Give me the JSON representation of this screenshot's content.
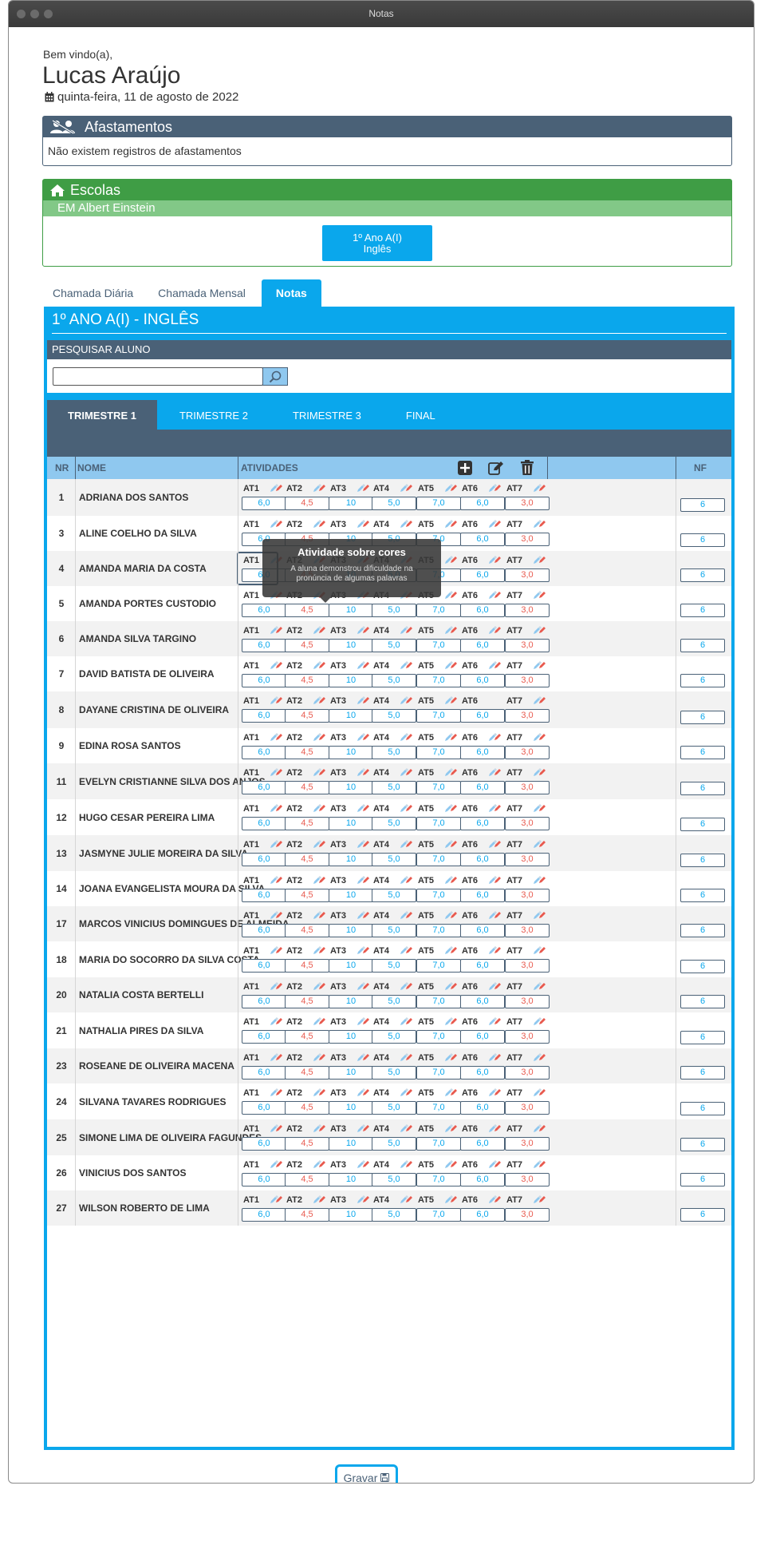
{
  "window": {
    "title": "Notas"
  },
  "header": {
    "welcome": "Bem vindo(a),",
    "user_name": "Lucas Araújo",
    "date": "quinta-feira, 11 de agosto de 2022"
  },
  "afastamentos": {
    "title": "Afastamentos",
    "message": "Não existem registros de afastamentos"
  },
  "escolas": {
    "title": "Escolas",
    "school_name": "EM Albert Einstein",
    "class_button_line1": "1º Ano A(I)",
    "class_button_line2": "Inglês"
  },
  "tabs": [
    {
      "label": "Chamada Diária",
      "active": false
    },
    {
      "label": "Chamada Mensal",
      "active": false
    },
    {
      "label": "Notas",
      "active": true
    }
  ],
  "notas": {
    "class_title": "1º ANO A(I) - INGLÊS",
    "search_label": "PESQUISAR ALUNO",
    "search_value": "",
    "trimestres": [
      "TRIMESTRE 1",
      "TRIMESTRE 2",
      "TRIMESTRE 3",
      "FINAL"
    ],
    "active_trimestre": 0,
    "columns": {
      "nr": "NR",
      "nome": "NOME",
      "atividades": "ATIVIDADES",
      "nf": "NF"
    },
    "activities": [
      "AT1",
      "AT2",
      "AT3",
      "AT4",
      "AT5",
      "AT6",
      "AT7"
    ],
    "grades": [
      "6,0",
      "4,5",
      "10",
      "5,0",
      "7,0",
      "6,0",
      "3,0"
    ],
    "grade_colors": [
      "blue",
      "red",
      "blue",
      "blue",
      "blue",
      "blue",
      "red"
    ],
    "nf_value": "6",
    "students": [
      {
        "nr": "1",
        "nome": "ADRIANA DOS SANTOS"
      },
      {
        "nr": "3",
        "nome": "ALINE COELHO DA SILVA"
      },
      {
        "nr": "4",
        "nome": "AMANDA MARIA DA COSTA"
      },
      {
        "nr": "5",
        "nome": "AMANDA PORTES CUSTODIO"
      },
      {
        "nr": "6",
        "nome": "AMANDA SILVA TARGINO"
      },
      {
        "nr": "7",
        "nome": "DAVID BATISTA DE OLIVEIRA"
      },
      {
        "nr": "8",
        "nome": "DAYANE CRISTINA DE OLIVEIRA"
      },
      {
        "nr": "9",
        "nome": "EDINA ROSA SANTOS"
      },
      {
        "nr": "11",
        "nome": "EVELYN CRISTIANNE SILVA DOS ANJOS"
      },
      {
        "nr": "12",
        "nome": "HUGO CESAR PEREIRA LIMA"
      },
      {
        "nr": "13",
        "nome": "JASMYNE JULIE MOREIRA DA SILVA"
      },
      {
        "nr": "14",
        "nome": "JOANA EVANGELISTA MOURA DA SILVA"
      },
      {
        "nr": "17",
        "nome": "MARCOS VINICIUS DOMINGUES DE ALMEIDA"
      },
      {
        "nr": "18",
        "nome": "MARIA DO SOCORRO DA SILVA COSTA"
      },
      {
        "nr": "20",
        "nome": "NATALIA COSTA BERTELLI"
      },
      {
        "nr": "21",
        "nome": "NATHALIA PIRES DA SILVA"
      },
      {
        "nr": "23",
        "nome": "ROSEANE DE OLIVEIRA MACENA"
      },
      {
        "nr": "24",
        "nome": "SILVANA TAVARES RODRIGUES"
      },
      {
        "nr": "25",
        "nome": "SIMONE LIMA DE OLIVEIRA FAGUNDES"
      },
      {
        "nr": "26",
        "nome": "VINICIUS DOS SANTOS"
      },
      {
        "nr": "27",
        "nome": "WILSON ROBERTO DE LIMA"
      }
    ],
    "row7_hidden_pencil": true,
    "tooltip": {
      "title": "Atividade sobre cores",
      "body": "A aluna demonstrou dificuldade na pronúncia de algumas palavras"
    }
  },
  "save_button": {
    "label": "Gravar"
  },
  "colors": {
    "primary": "#0aa7ec",
    "dark": "#4a6177",
    "success": "#3f9d45",
    "grade_red": "#e85a4f"
  }
}
